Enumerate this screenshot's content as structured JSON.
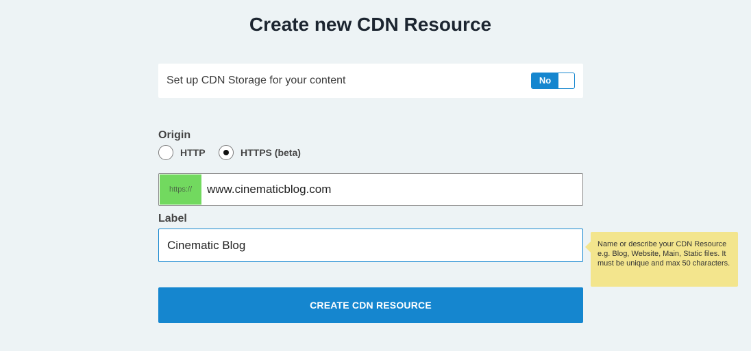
{
  "page": {
    "title": "Create new CDN Resource"
  },
  "storage": {
    "text": "Set up CDN Storage for your content",
    "toggle_label": "No"
  },
  "origin": {
    "label": "Origin",
    "options": [
      {
        "label": "HTTP",
        "checked": false
      },
      {
        "label": "HTTPS (beta)",
        "checked": true
      }
    ],
    "prefix": "https://",
    "value": "www.cinematicblog.com"
  },
  "label_field": {
    "label": "Label",
    "value": "Cinematic Blog",
    "tooltip": "Name or describe your CDN Resource e.g. Blog, Website, Main, Static files. It must be unique and max 50 characters."
  },
  "actions": {
    "create_label": "CREATE CDN RESOURCE"
  },
  "colors": {
    "accent": "#1586cf",
    "prefix_bg": "#72d95f",
    "tooltip_bg": "#f3e58d",
    "page_bg": "#edf3f5"
  }
}
